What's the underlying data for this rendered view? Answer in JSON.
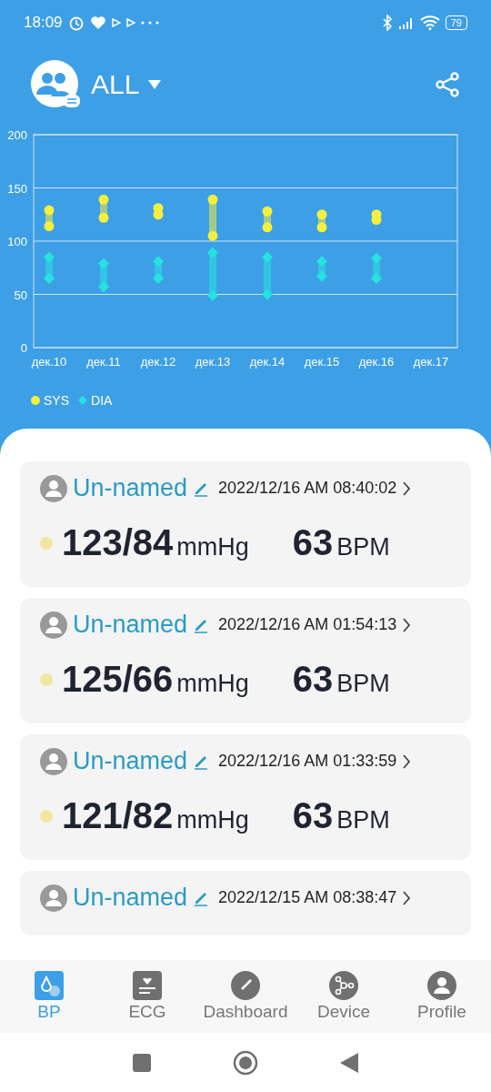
{
  "status_bar": {
    "time": "18:09",
    "battery": "79"
  },
  "header": {
    "group": "ALL"
  },
  "chart": {
    "chart_data": {
      "type": "scatter",
      "categories": [
        "дек.10",
        "дек.11",
        "дек.12",
        "дек.13",
        "дек.14",
        "дек.15",
        "дек.16",
        "дек.17"
      ],
      "ylim": [
        0,
        200
      ],
      "yticks": [
        0,
        50,
        100,
        150,
        200
      ],
      "grid": true,
      "series": [
        {
          "name": "SYS",
          "color": "#f5ef3e",
          "values": [
            129,
            139,
            131,
            139,
            128,
            125,
            125,
            null
          ]
        },
        {
          "color": "#f5ef3e",
          "values": [
            114,
            122,
            125,
            105,
            113,
            113,
            120,
            null
          ]
        },
        {
          "name": "DIA",
          "color": "#26e3e0",
          "values": [
            85,
            79,
            81,
            89,
            85,
            81,
            84,
            null
          ]
        },
        {
          "color": "#26e3e0",
          "values": [
            65,
            57,
            65,
            49,
            50,
            67,
            65,
            null
          ]
        }
      ]
    }
  },
  "records": [
    {
      "name": "Un-named",
      "time": "2022/12/16 AM 08:40:02",
      "reading": "123/84",
      "unit": "mmHg",
      "pulse": "63",
      "pulse_unit": "BPM"
    },
    {
      "name": "Un-named",
      "time": "2022/12/16 AM 01:54:13",
      "reading": "125/66",
      "unit": "mmHg",
      "pulse": "63",
      "pulse_unit": "BPM"
    },
    {
      "name": "Un-named",
      "time": "2022/12/16 AM 01:33:59",
      "reading": "121/82",
      "unit": "mmHg",
      "pulse": "63",
      "pulse_unit": "BPM"
    },
    {
      "name": "Un-named",
      "time": "2022/12/15 AM 08:38:47"
    }
  ],
  "nav": [
    {
      "label": "BP",
      "selected": true
    },
    {
      "label": "ECG",
      "selected": false
    },
    {
      "label": "Dashboard",
      "selected": false
    },
    {
      "label": "Device",
      "selected": false
    },
    {
      "label": "Profile",
      "selected": false
    }
  ]
}
